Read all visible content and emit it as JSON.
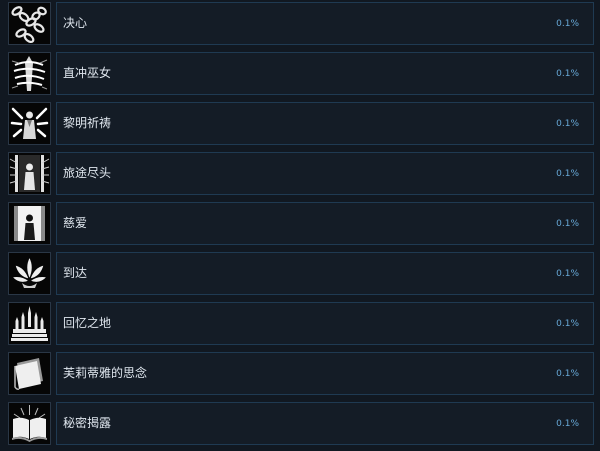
{
  "achievements": [
    {
      "name": "决心",
      "percent": "0.1%",
      "icon": "chains-icon"
    },
    {
      "name": "直冲巫女",
      "percent": "0.1%",
      "icon": "wrapped-figure-icon"
    },
    {
      "name": "黎明祈祷",
      "percent": "0.1%",
      "icon": "praying-figure-icon"
    },
    {
      "name": "旅途尽头",
      "percent": "0.1%",
      "icon": "doorway-figure-icon"
    },
    {
      "name": "慈爱",
      "percent": "0.1%",
      "icon": "lit-doorway-figure-icon"
    },
    {
      "name": "到达",
      "percent": "0.1%",
      "icon": "lotus-icon"
    },
    {
      "name": "回忆之地",
      "percent": "0.1%",
      "icon": "castle-icon"
    },
    {
      "name": "芙莉蒂雅的思念",
      "percent": "0.1%",
      "icon": "letter-icon"
    },
    {
      "name": "秘密揭露",
      "percent": "0.1%",
      "icon": "open-book-icon"
    }
  ]
}
